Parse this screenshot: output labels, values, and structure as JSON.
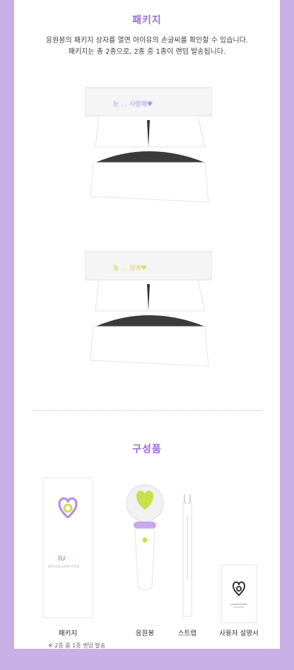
{
  "section1": {
    "title": "패키지",
    "desc_line1": "응원봉의 패키지 상자를 열면 아이유의 손글씨를 확인할 수 있습니다.",
    "desc_line2": "패키지는 총 2종으로, 2종 중 1종이 랜덤 발송됩니다."
  },
  "section2": {
    "title": "구성품",
    "items": [
      {
        "label": "패키지",
        "icon": "package-box-icon"
      },
      {
        "label": "응원봉",
        "icon": "lightstick-icon"
      },
      {
        "label": "스트랩",
        "icon": "strap-icon"
      },
      {
        "label": "사용자 설명서",
        "icon": "manual-icon"
      }
    ],
    "box_text": "IU",
    "box_subtext": "OFFICIAL LIGHT STICK",
    "note": "※ 2종 중 1종 랜덤 발송"
  },
  "colors": {
    "background": "#c9b0e6",
    "accent": "#9a6ad6",
    "logo_green": "#c8e04a",
    "logo_purple": "#b48be6"
  }
}
